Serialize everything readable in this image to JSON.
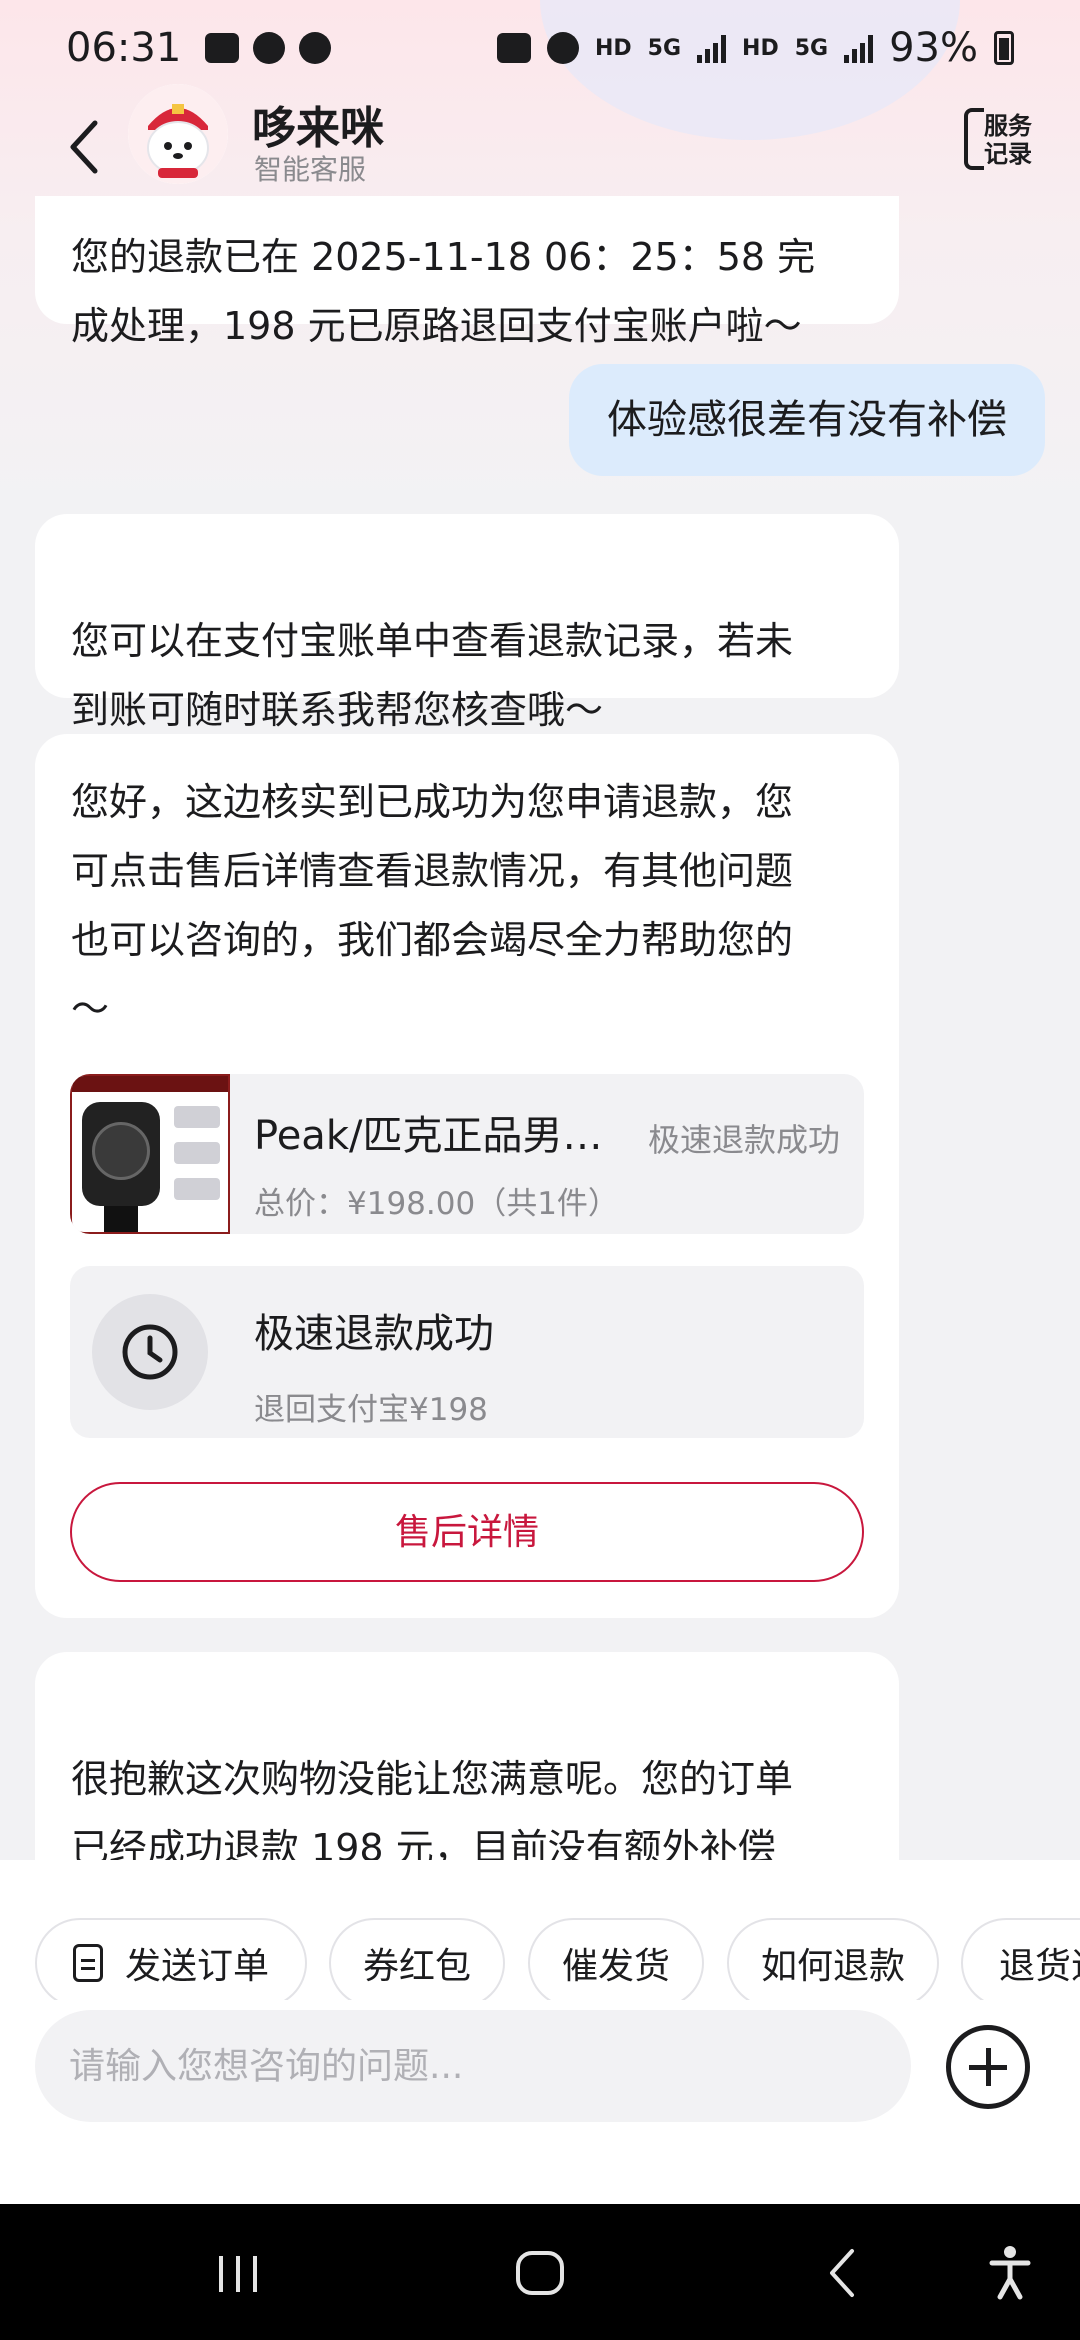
{
  "status_bar": {
    "time": "06:31",
    "net_hd_1": "HD",
    "net_5g_1": "5G",
    "net_hd_2": "HD",
    "net_5g_2": "5G",
    "battery": "93%"
  },
  "header": {
    "title": "哆来咪",
    "subtitle": "智能客服",
    "service_record": "服务\n记录"
  },
  "messages": [
    {
      "side": "left",
      "text": "您的退款已在 2025-11-18 06：25：58 完\n成处理，198 元已原路退回支付宝账户啦～"
    },
    {
      "side": "right",
      "text": "体验感很差有没有补偿"
    },
    {
      "side": "left",
      "text": "您可以在支付宝账单中查看退款记录，若未\n到账可随时联系我帮您核查哦～"
    },
    {
      "side": "left",
      "text": "您好，这边核实到已成功为您申请退款，您\n可点击售后详情查看退款情况，有其他问题\n也可以咨询的，我们都会竭尽全力帮助您的\n～"
    },
    {
      "side": "left",
      "text": "很抱歉这次购物没能让您满意呢。您的订单\n已经成功退款 198 元，目前没有额外补偿\n方案哦，希望下次能给您带来更好的体验～"
    }
  ],
  "order_card": {
    "product_name": "Peak/匹克正品男…",
    "status": "极速退款成功",
    "price": "总价：¥198.00（共1件）",
    "refund_title": "极速退款成功",
    "refund_sub": "退回支付宝¥198",
    "aftersale_label": "售后详情"
  },
  "quick_replies": [
    "发送订单",
    "券红包",
    "催发货",
    "如何退款",
    "退货退"
  ],
  "input": {
    "placeholder": "请输入您想咨询的问题..."
  },
  "icons": {
    "back": "chevron-left-icon",
    "service_record": "service-record-icon",
    "clock": "clock-icon",
    "order": "document-icon",
    "plus": "plus-circle-icon"
  },
  "colors": {
    "accent": "#c8173d",
    "bubble_user": "#dcebfc",
    "bubble_bot": "#ffffff",
    "background": "#f2f2f4"
  }
}
